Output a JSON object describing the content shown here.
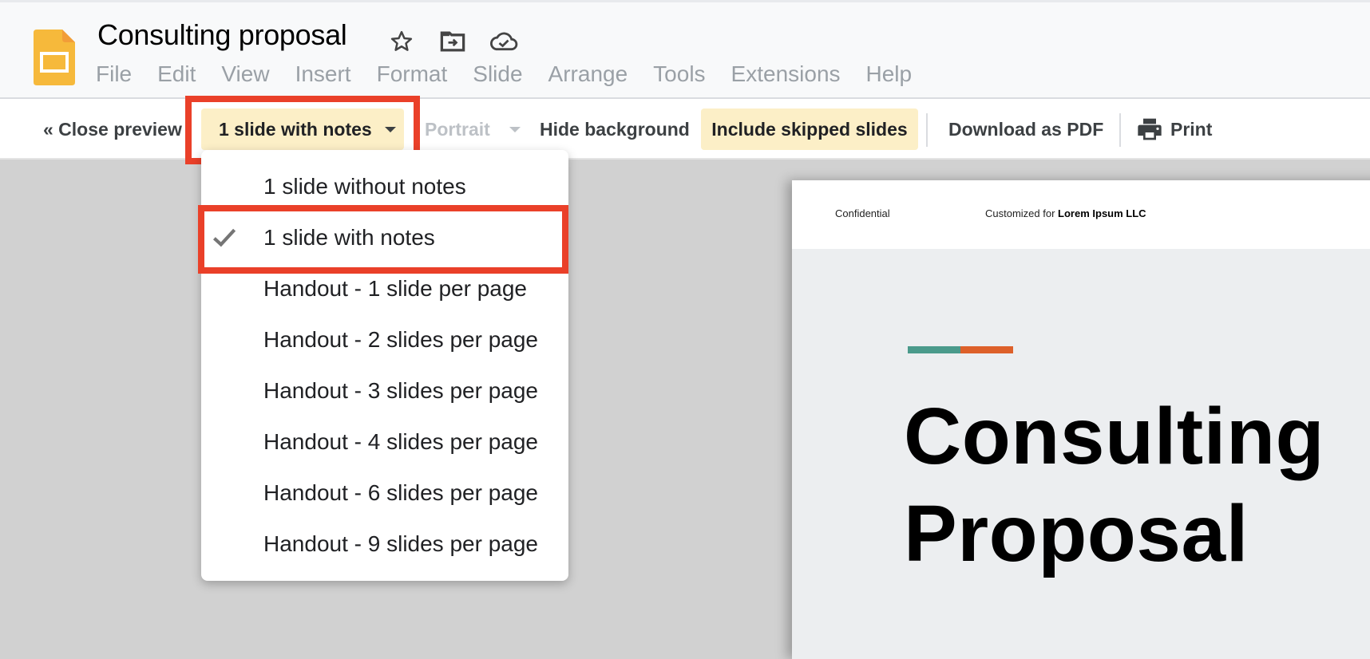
{
  "app": {
    "document_title": "Consulting proposal",
    "icons": [
      "star-icon",
      "move-to-folder-icon",
      "cloud-saved-icon"
    ],
    "brand_color": "#f6b93b"
  },
  "menubar": {
    "items": [
      "File",
      "Edit",
      "View",
      "Insert",
      "Format",
      "Slide",
      "Arrange",
      "Tools",
      "Extensions",
      "Help"
    ]
  },
  "toolbar": {
    "close_preview": "« Close preview",
    "layout_selected": "1 slide with notes",
    "orientation": "Portrait",
    "hide_background": "Hide background",
    "include_skipped": "Include skipped slides",
    "download_pdf": "Download as PDF",
    "print": "Print",
    "highlight_color": "#ea4029",
    "active_button_bg": "#fcefc7"
  },
  "layout_dropdown": {
    "selected_index": 1,
    "options": [
      "1 slide without notes",
      "1 slide with notes",
      "Handout - 1 slide per page",
      "Handout - 2 slides per page",
      "Handout - 3 slides per page",
      "Handout - 4 slides per page",
      "Handout - 6 slides per page",
      "Handout - 9 slides per page"
    ]
  },
  "slide": {
    "confidential": "Confidential",
    "customized_prefix": "Customized for ",
    "customized_client": "Lorem Ipsum LLC",
    "title_line1": "Consulting",
    "title_line2": "Proposal",
    "accent_colors": [
      "#4a9a8b",
      "#dd602a"
    ]
  }
}
